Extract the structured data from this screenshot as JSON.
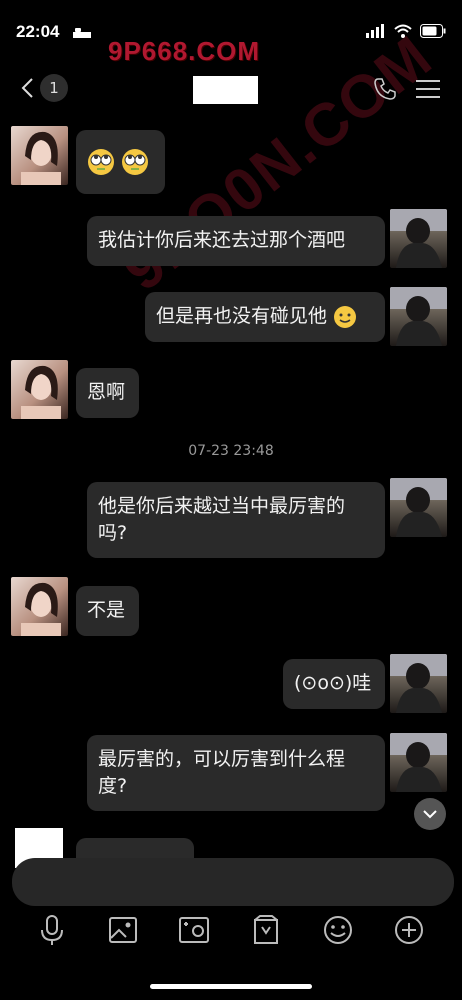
{
  "status": {
    "time": "22:04"
  },
  "watermark": {
    "top": "9P668.COM",
    "diagonal": "9PO0N.COM"
  },
  "nav": {
    "back_badge": "1"
  },
  "messages": [
    {
      "side": "left",
      "text": ""
    },
    {
      "side": "right",
      "text": "我估计你后来还去过那个酒吧"
    },
    {
      "side": "right",
      "text": "但是再也没有碰见他"
    },
    {
      "side": "left",
      "text": "恩啊"
    },
    {
      "side": "right",
      "text": "他是你后来越过当中最厉害的吗?"
    },
    {
      "side": "left",
      "text": "不是"
    },
    {
      "side": "right",
      "text": "(⊙o⊙)哇"
    },
    {
      "side": "right",
      "text": "最厉害的，可以厉害到什么程度?"
    }
  ],
  "timestamp": "07-23 23:48",
  "icons": [
    "microphone-icon",
    "image-icon",
    "camera-icon",
    "file-icon",
    "emoji-icon",
    "plus-icon"
  ],
  "colors": {
    "bubble": "#2a2a2a",
    "background": "#000000",
    "watermark": "#b01830"
  }
}
